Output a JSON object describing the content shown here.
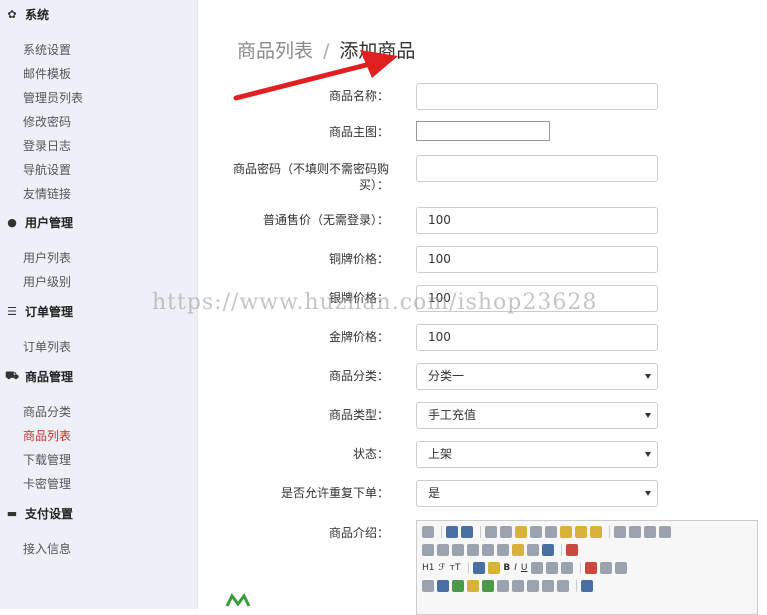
{
  "sidebar": {
    "sections": [
      {
        "title": "系统",
        "icon": "gear-icon",
        "items": [
          "系统设置",
          "邮件模板",
          "管理员列表",
          "修改密码",
          "登录日志",
          "导航设置",
          "友情链接"
        ]
      },
      {
        "title": "用户管理",
        "icon": "user-icon",
        "items": [
          "用户列表",
          "用户级别"
        ]
      },
      {
        "title": "订单管理",
        "icon": "list-icon",
        "items": [
          "订单列表"
        ]
      },
      {
        "title": "商品管理",
        "icon": "cart-icon",
        "items": [
          "商品分类",
          "商品列表",
          "下载管理",
          "卡密管理"
        ]
      },
      {
        "title": "支付设置",
        "icon": "card-icon",
        "items": [
          "接入信息"
        ]
      }
    ],
    "active_item": "商品列表"
  },
  "breadcrumb": {
    "parent": "商品列表",
    "separator": "/",
    "current": "添加商品"
  },
  "form": {
    "name_label": "商品名称：",
    "name_value": "",
    "image_label": "商品主图：",
    "password_label": "商品密码（不填则不需密码购买）：",
    "password_value": "",
    "normal_price_label": "普通售价（无需登录）：",
    "normal_price_value": "100",
    "bronze_price_label": "铜牌价格：",
    "bronze_price_value": "100",
    "silver_price_label": "银牌价格：",
    "silver_price_value": "100",
    "gold_price_label": "金牌价格：",
    "gold_price_value": "100",
    "category_label": "商品分类：",
    "category_value": "分类一",
    "type_label": "商品类型：",
    "type_value": "手工充值",
    "status_label": "状态：",
    "status_value": "上架",
    "repeat_label": "是否允许重复下单：",
    "repeat_value": "是",
    "intro_label": "商品介绍："
  },
  "editor": {
    "heading_btn": "H1",
    "font_btn": "ℱ",
    "size_btn": "тT",
    "bold_btn": "B",
    "italic_btn": "I",
    "underline_btn": "U"
  },
  "watermark": "https://www.huzhan.com/ishop23628"
}
